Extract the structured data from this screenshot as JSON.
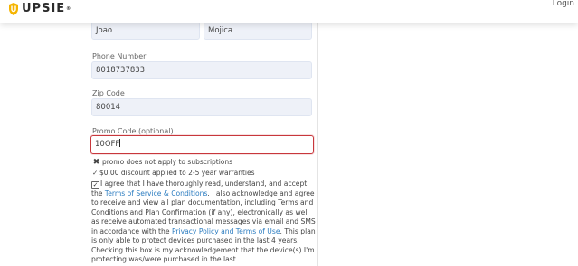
{
  "header": {
    "brand": "UPSIE",
    "brand_mark": "®",
    "login_label": "Login"
  },
  "form": {
    "first_name_value": "Joao",
    "last_name_value": "Mojica",
    "phone": {
      "label": "Phone Number",
      "value": "8018737833"
    },
    "zip": {
      "label": "Zip Code",
      "value": "80014"
    },
    "promo": {
      "label": "Promo Code (optional)",
      "value": "10OFF"
    },
    "promo_messages": {
      "subscriptions_note": "promo does not apply to subscriptions",
      "discount_note": "$0.00 discount applied to 2-5 year warranties"
    },
    "terms": {
      "checked": true,
      "text_1": "I agree that I have thoroughly read, understand, and accept the ",
      "link_terms": "Terms of Service & Conditions",
      "text_2": ". I also acknowledge and agree to receive and view all plan documentation, including Terms and Conditions and Plan Confirmation (if any), electronically as well as receive automated transactional messages via email and SMS in accordance with the ",
      "link_privacy": "Privacy Policy and Terms of Use",
      "text_3": ". This plan is only able to protect devices purchased in the last 4 years. Checking this box is my acknowledgement that the device(s) I'm protecting was/were purchased in the last"
    }
  },
  "colors": {
    "accent_link": "#2b7cc0",
    "error_border": "#c8373c",
    "field_bg": "#eef1f8",
    "logo_gold": "#f5b400"
  }
}
